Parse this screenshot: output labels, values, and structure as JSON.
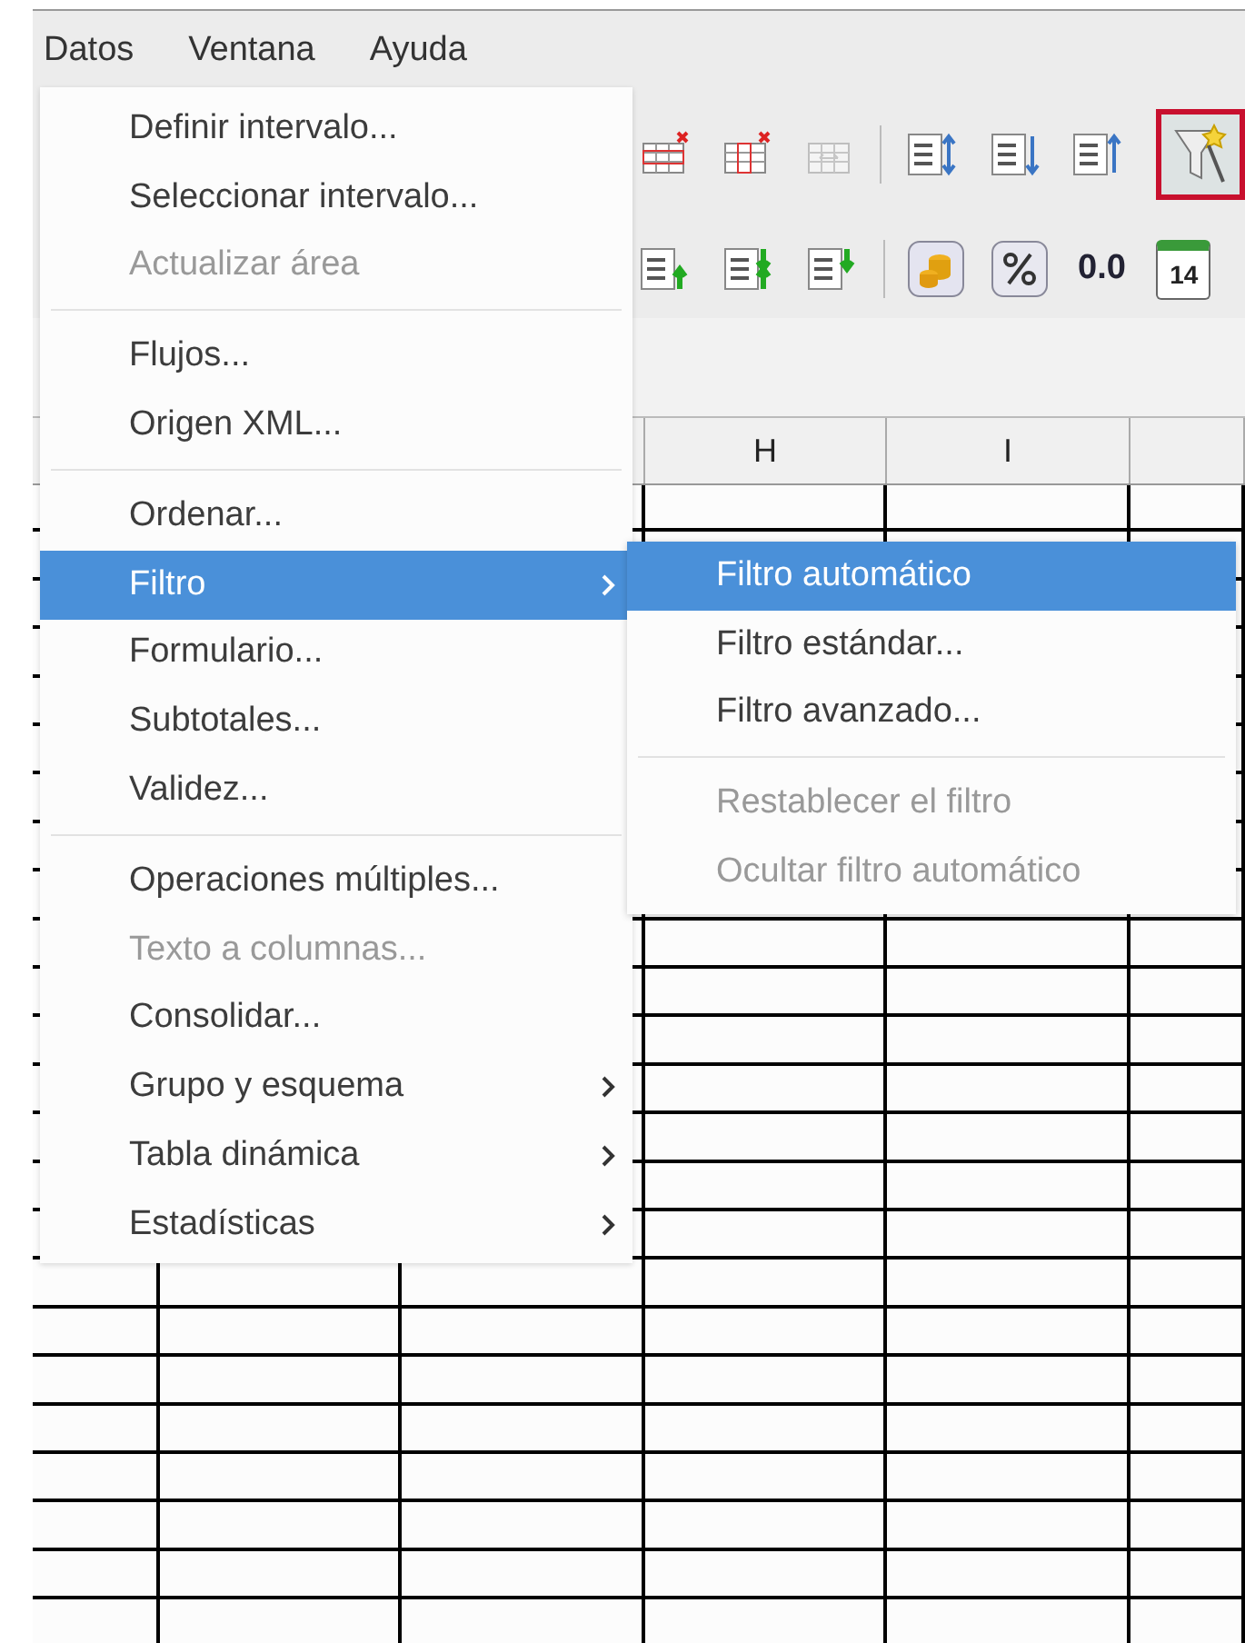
{
  "menubar": [
    {
      "label": "Datos"
    },
    {
      "label": "Ventana"
    },
    {
      "label": "Ayuda"
    }
  ],
  "toolbar": {
    "rows": [
      [
        {
          "kind": "delete-rows"
        },
        {
          "kind": "delete-columns"
        },
        {
          "kind": "merge",
          "disabled": true
        },
        {
          "kind": "separator"
        },
        {
          "kind": "sort"
        },
        {
          "kind": "sort-asc"
        },
        {
          "kind": "sort-desc"
        },
        {
          "kind": "autofilter",
          "highlighted": true
        }
      ],
      [
        {
          "kind": "sort-up"
        },
        {
          "kind": "sort-both"
        },
        {
          "kind": "sort-down"
        },
        {
          "kind": "separator"
        },
        {
          "kind": "currency"
        },
        {
          "kind": "percent"
        },
        {
          "kind": "text",
          "label": "0.0"
        },
        {
          "kind": "calendar",
          "label": "14"
        }
      ]
    ]
  },
  "sheet": {
    "column_headers": [
      "H",
      "I"
    ]
  },
  "menu": [
    {
      "kind": "item",
      "label": "Definir intervalo...",
      "disabled": false,
      "selected": false,
      "has_submenu": false
    },
    {
      "kind": "item",
      "label": "Seleccionar intervalo...",
      "disabled": false,
      "selected": false,
      "has_submenu": false
    },
    {
      "kind": "item",
      "label": "Actualizar área",
      "disabled": true,
      "selected": false,
      "has_submenu": false
    },
    {
      "kind": "separator"
    },
    {
      "kind": "item",
      "label": "Flujos...",
      "disabled": false,
      "selected": false,
      "has_submenu": false
    },
    {
      "kind": "item",
      "label": "Origen XML...",
      "disabled": false,
      "selected": false,
      "has_submenu": false
    },
    {
      "kind": "separator"
    },
    {
      "kind": "item",
      "label": "Ordenar...",
      "disabled": false,
      "selected": false,
      "has_submenu": false
    },
    {
      "kind": "item",
      "label": "Filtro",
      "disabled": false,
      "selected": true,
      "has_submenu": true
    },
    {
      "kind": "item",
      "label": "Formulario...",
      "disabled": false,
      "selected": false,
      "has_submenu": false
    },
    {
      "kind": "item",
      "label": "Subtotales...",
      "disabled": false,
      "selected": false,
      "has_submenu": false
    },
    {
      "kind": "item",
      "label": "Validez...",
      "disabled": false,
      "selected": false,
      "has_submenu": false
    },
    {
      "kind": "separator"
    },
    {
      "kind": "item",
      "label": "Operaciones múltiples...",
      "disabled": false,
      "selected": false,
      "has_submenu": false
    },
    {
      "kind": "item",
      "label": "Texto a columnas...",
      "disabled": true,
      "selected": false,
      "has_submenu": false
    },
    {
      "kind": "item",
      "label": "Consolidar...",
      "disabled": false,
      "selected": false,
      "has_submenu": false
    },
    {
      "kind": "item",
      "label": "Grupo y esquema",
      "disabled": false,
      "selected": false,
      "has_submenu": true
    },
    {
      "kind": "item",
      "label": "Tabla dinámica",
      "disabled": false,
      "selected": false,
      "has_submenu": true
    },
    {
      "kind": "item",
      "label": "Estadísticas",
      "disabled": false,
      "selected": false,
      "has_submenu": true
    }
  ],
  "submenu": [
    {
      "kind": "item",
      "label": "Filtro automático",
      "disabled": false,
      "selected": true
    },
    {
      "kind": "item",
      "label": "Filtro estándar...",
      "disabled": false,
      "selected": false
    },
    {
      "kind": "item",
      "label": "Filtro avanzado...",
      "disabled": false,
      "selected": false
    },
    {
      "kind": "separator"
    },
    {
      "kind": "item",
      "label": "Restablecer el filtro",
      "disabled": true,
      "selected": false
    },
    {
      "kind": "item",
      "label": "Ocultar filtro automático",
      "disabled": true,
      "selected": false
    }
  ]
}
